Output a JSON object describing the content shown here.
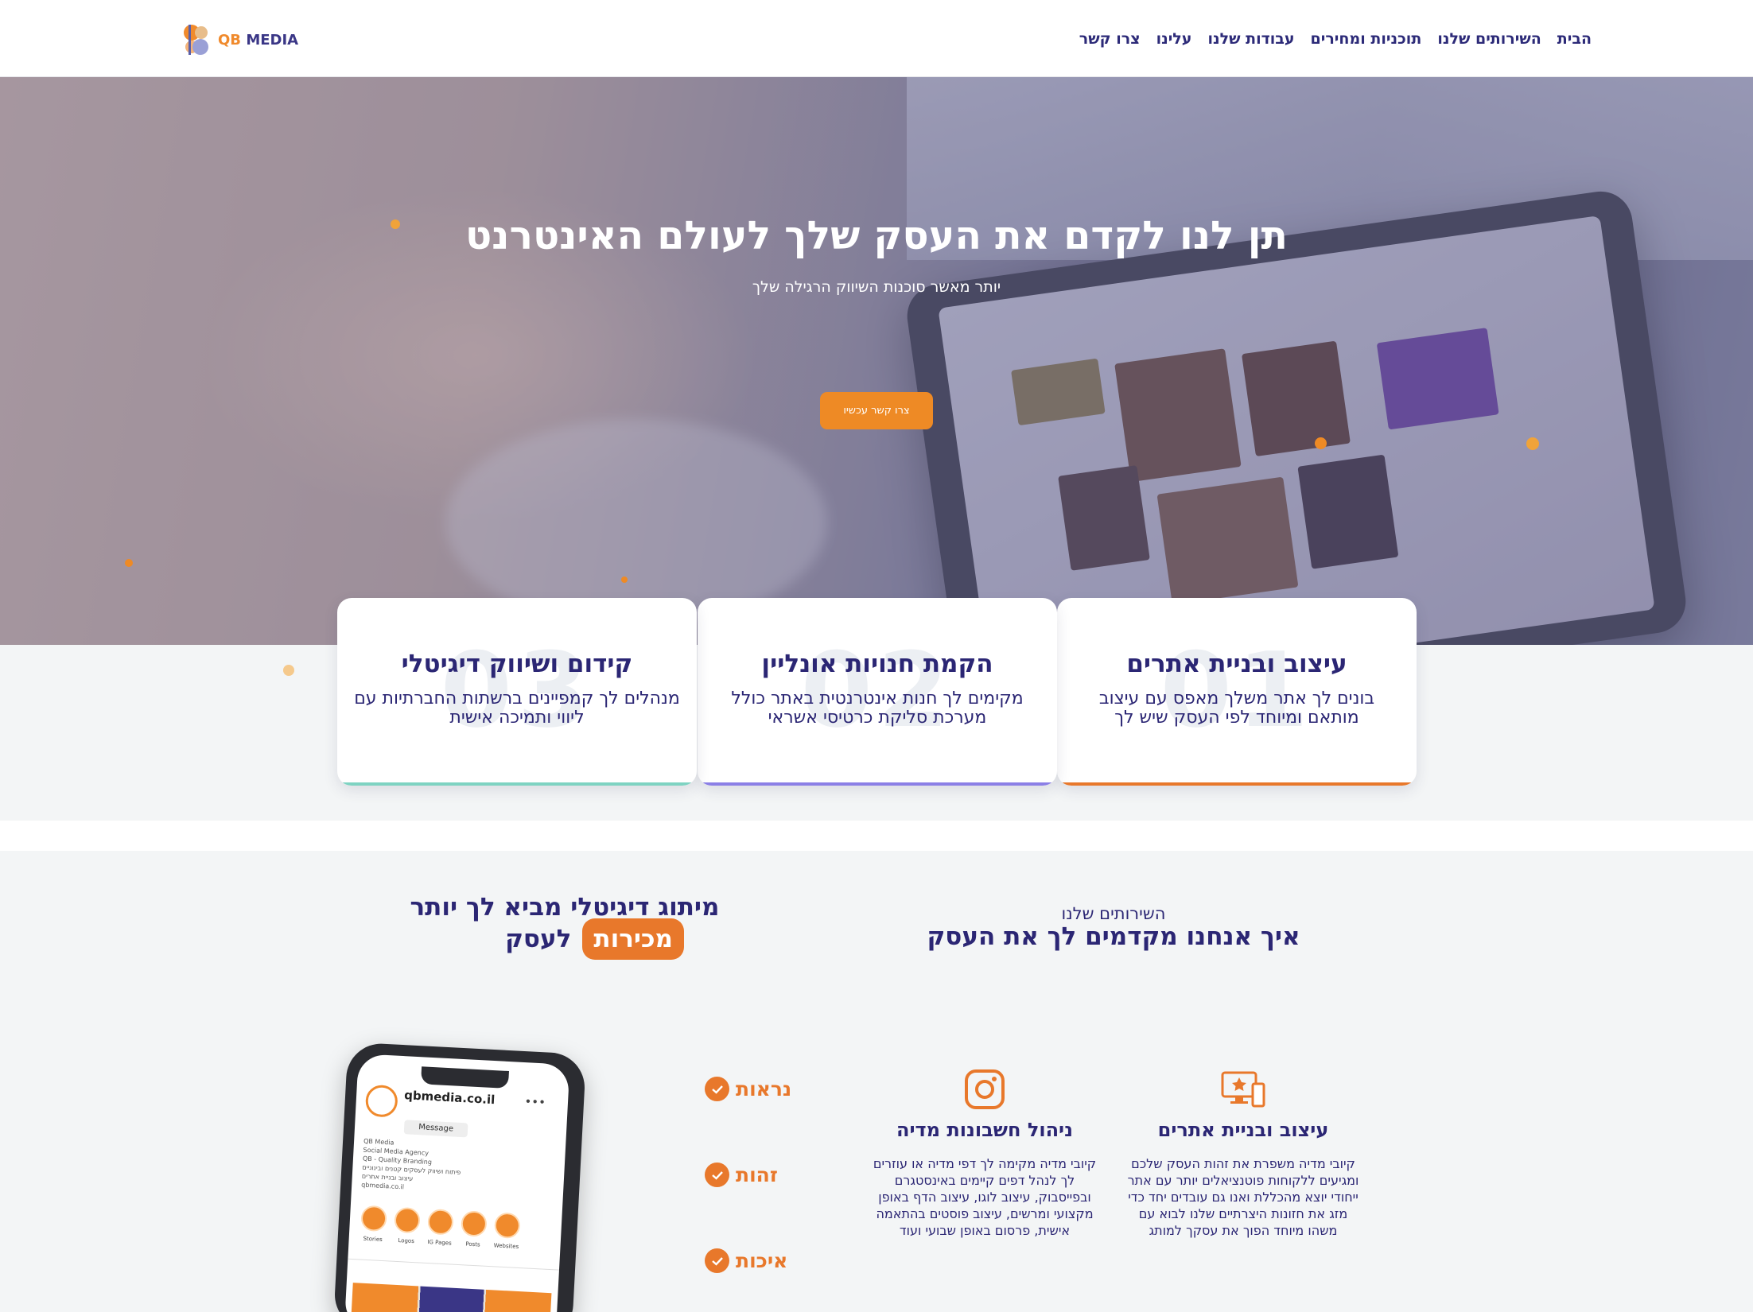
{
  "header": {
    "brand_qb": "QB",
    "brand_media": "MEDIA",
    "nav": [
      "הבית",
      "השירותים שלנו",
      "תוכניות ומחירים",
      "עבודות שלנו",
      "עלינו",
      "צרו קשר"
    ]
  },
  "hero": {
    "title": "תן לנו לקדם את העסק שלך לעולם האינטרנט",
    "subtitle": "יותר מאשר סוכנות השיווק הרגילה שלך",
    "cta": "צרו קשר עכשיו"
  },
  "features": [
    {
      "num": "01",
      "title": "עיצוב ובניית אתרים",
      "text": "בונים לך אתר משלך מאפס עם עיצוב מותאם ומיוחד לפי העסק שיש לך",
      "accent": "#e8782b"
    },
    {
      "num": "02",
      "title": "הקמת חנויות אונליין",
      "text": "מקימים לך חנות אינטרנטית באתר כולל מערכת סליקת כרטיסי אשראי",
      "accent": "#8b7fe6"
    },
    {
      "num": "03",
      "title": "קידום ושיווק דיגיטלי",
      "text": "מנהלים לך קמפיינים ברשתות החברתיות עם ליווי ותמיכה אישית",
      "accent": "#7ed3c2"
    }
  ],
  "services": {
    "label": "השירותים שלנו",
    "title": "איך אנחנו מקדמים לך את העסק",
    "items": [
      {
        "icon": "monitor-star-icon",
        "title": "עיצוב ובניית אתרים",
        "text": "קיובי מדיה משפרת את זהות העסק שלכם ומגיעים ללקוחות פוטנציאלים יותר עם אתר ייחודי יוצא מהכללת ואנו גם עובדים יחד כדי מזג את חזונות היצרתיים שלנו לבוא עם משהו מיוחד הפוך את עסקך למותג"
      },
      {
        "icon": "instagram-icon",
        "title": "ניהול חשבונות מדיה",
        "text": "קיובי מדיה מקימה לך דפי מדיה או עוזרים לך לנהל דפים קיימים באינסטגרם ובפייסבוק, עיצוב לוגו, עיצוב הדף באופן מקצועי ומרשים, עיצוב פוסטים בהתאמה אישית, פרסום באופן שבועי ועוד"
      }
    ]
  },
  "digital": {
    "line1": "מיתוג דיגיטלי מביא לך יותר",
    "highlight": "מכירות",
    "line2_rest": "לעסק",
    "checks": [
      "נראות",
      "זהות",
      "איכות"
    ]
  },
  "phone": {
    "url": "qbmedia.co.il",
    "message": "Message",
    "bio": [
      "QB Media",
      "Social Media Agency",
      "QB - Quality Branding",
      "פיתוח ושיווק לעסקים קטנים ובינוניים",
      "עיצוב ובניית אתרים",
      "qbmedia.co.il"
    ],
    "highlights": [
      "Stories",
      "Logos",
      "IG Pages",
      "Posts",
      "Websites"
    ]
  },
  "colors": {
    "accent_orange": "#e8782b",
    "brand_navy": "#2b2674"
  }
}
